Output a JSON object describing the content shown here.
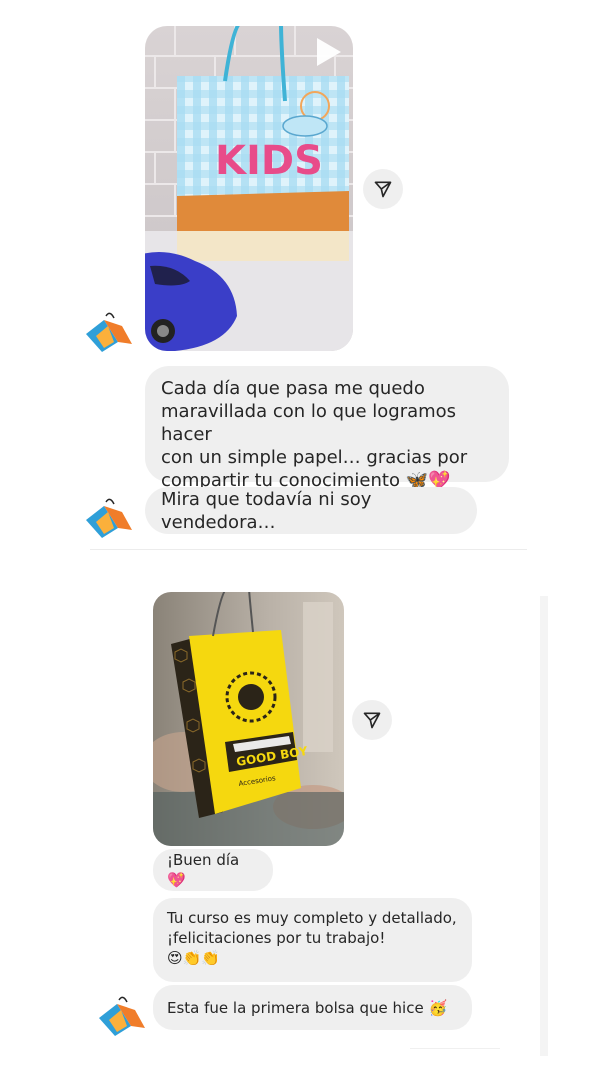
{
  "thread_top": {
    "message_1": {
      "lines": [
        "Cada día que pasa me quedo",
        "maravillada con lo que logramos hacer",
        "con un simple papel… gracias por",
        "compartir tu conocimiento 🦋💖"
      ]
    },
    "message_2": {
      "text": "Mira que todavía ni soy vendedora…"
    },
    "media": {
      "bag_text": "KIDS",
      "play_icon": "play-icon"
    }
  },
  "thread_bottom": {
    "media": {
      "bag_text": "GOOD BOY",
      "bag_subtext": "Accesorios"
    },
    "message_1": {
      "text": "¡Buen día 💖"
    },
    "message_2": {
      "lines": [
        "Tu curso es muy completo y detallado,",
        "¡felicitaciones por tu trabajo!",
        "😍👏👏"
      ]
    },
    "message_3": {
      "text": "Esta fue la primera bolsa que hice 🥳"
    }
  },
  "icons": {
    "share": "send-icon",
    "avatar": "paper-bags-logo"
  },
  "colors": {
    "bubble": "#efefef",
    "text": "#262626",
    "avatar_blue": "#2f9fd8",
    "avatar_orange": "#f07d2a",
    "bag_yellow": "#f5d80f"
  }
}
